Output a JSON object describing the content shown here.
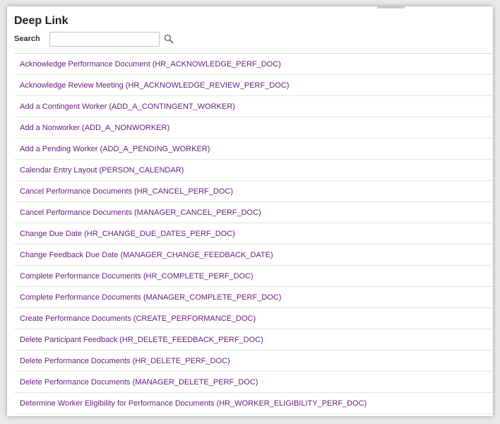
{
  "page": {
    "title": "Deep Link"
  },
  "search": {
    "label": "Search",
    "value": "",
    "placeholder": ""
  },
  "links": [
    "Acknowledge Performance Document (HR_ACKNOWLEDGE_PERF_DOC)",
    "Acknowledge Review Meeting (HR_ACKNOWLEDGE_REVIEW_PERF_DOC)",
    "Add a Contingent Worker (ADD_A_CONTINGENT_WORKER)",
    "Add a Nonworker (ADD_A_NONWORKER)",
    "Add a Pending Worker (ADD_A_PENDING_WORKER)",
    "Calendar Entry Layout (PERSON_CALENDAR)",
    "Cancel Performance Documents (HR_CANCEL_PERF_DOC)",
    "Cancel Performance Documents (MANAGER_CANCEL_PERF_DOC)",
    "Change Due Date (HR_CHANGE_DUE_DATES_PERF_DOC)",
    "Change Feedback Due Date (MANAGER_CHANGE_FEEDBACK_DATE)",
    "Complete Performance Documents (HR_COMPLETE_PERF_DOC)",
    "Complete Performance Documents (MANAGER_COMPLETE_PERF_DOC)",
    "Create Performance Documents (CREATE_PERFORMANCE_DOC)",
    "Delete Participant Feedback (HR_DELETE_FEEDBACK_PERF_DOC)",
    "Delete Performance Documents (HR_DELETE_PERF_DOC)",
    "Delete Performance Documents (MANAGER_DELETE_PERF_DOC)",
    "Determine Worker Eligibility for Performance Documents (HR_WORKER_ELIGIBILITY_PERF_DOC)"
  ],
  "colors": {
    "link": "#6b1e82",
    "title": "#222222",
    "background": "#ffffff"
  },
  "icons": {
    "search": "search-icon"
  }
}
